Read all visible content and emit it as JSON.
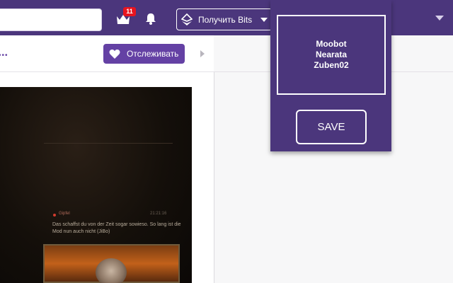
{
  "colors": {
    "nav_bg": "#4b367c",
    "accent": "#6441a4",
    "badge": "#e8141f"
  },
  "topnav": {
    "search_placeholder": "",
    "prime_icon": "crown-icon",
    "prime_badge": "11",
    "notifications_icon": "bell-icon",
    "bits_icon": "bits-gem-icon",
    "bits_label": "Получить Bits",
    "user_menu_icon": "chevron-down-icon"
  },
  "channel": {
    "more_dots": "•••",
    "follow_icon": "heart-icon",
    "follow_label": "Отслеживать"
  },
  "video_chat": {
    "user": "Gipfel",
    "time": "21:21:16",
    "message": "Das schaffst du von der Zeit sogar sowieso. So lang ist die Mod nun auch nicht (JiBo)"
  },
  "popup": {
    "names": [
      "Moobot",
      "Nearata",
      "Zuben02"
    ],
    "save_label": "SAVE"
  }
}
